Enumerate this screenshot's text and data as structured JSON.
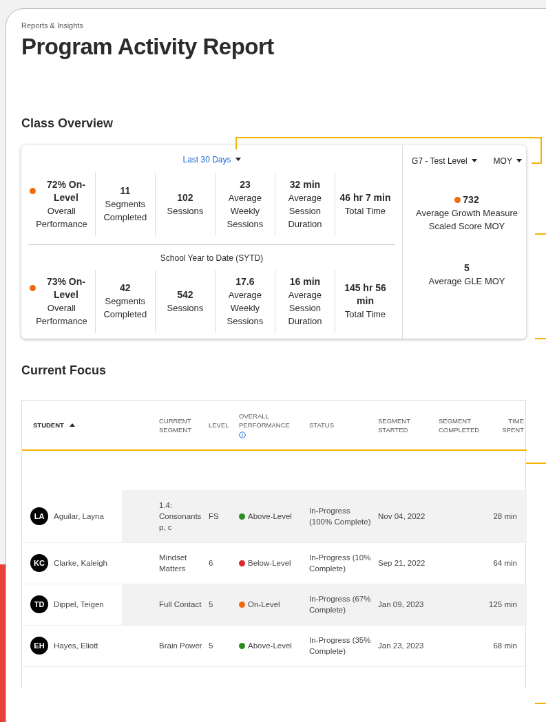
{
  "breadcrumb": "Reports & Insights",
  "title": "Program Activity Report",
  "class_overview": {
    "heading": "Class Overview",
    "period_filter": "Last 30 Days",
    "periods": [
      {
        "stats": [
          {
            "kind": "performance",
            "value": "72% On-Level",
            "label": "Overall Performance",
            "color": "#ee6c0c"
          },
          {
            "kind": "plain",
            "value": "11",
            "label": "Segments Completed"
          },
          {
            "kind": "plain",
            "value": "102",
            "label": "Sessions"
          },
          {
            "kind": "plain",
            "value": "23",
            "label": "Average Weekly Sessions"
          },
          {
            "kind": "plain",
            "value": "32 min",
            "label": "Average Session Duration"
          },
          {
            "kind": "plain",
            "value": "46 hr 7 min",
            "label": "Total Time"
          }
        ]
      },
      {
        "label": "School Year to Date (SYTD)",
        "stats": [
          {
            "kind": "performance",
            "value": "73% On-Level",
            "label": "Overall Performance",
            "color": "#ee6c0c"
          },
          {
            "kind": "plain",
            "value": "42",
            "label": "Segments Completed"
          },
          {
            "kind": "plain",
            "value": "542",
            "label": "Sessions"
          },
          {
            "kind": "plain",
            "value": "17.6",
            "label": "Average Weekly Sessions"
          },
          {
            "kind": "plain",
            "value": "16 min",
            "label": "Average Session Duration"
          },
          {
            "kind": "plain",
            "value": "145 hr 56 min",
            "label": "Total Time"
          }
        ]
      }
    ],
    "level_filter": "G7 - Test Level",
    "term_filter": "MOY",
    "measures": [
      {
        "value": "732",
        "label": "Average Growth Measure Scaled Score MOY",
        "color": "#ee6c0c"
      },
      {
        "value": "5",
        "label": "Average GLE MOY"
      }
    ]
  },
  "current_focus": {
    "heading": "Current Focus",
    "columns": [
      {
        "label": "STUDENT",
        "sorted": true
      },
      {
        "label": "CURRENT SEGMENT",
        "sorted": false
      },
      {
        "label": "LEVEL",
        "sorted": false
      },
      {
        "label": "OVERALL PERFORMANCE",
        "sorted": false,
        "info": true
      },
      {
        "label": "STATUS",
        "sorted": false
      },
      {
        "label": "SEGMENT STARTED",
        "sorted": false
      },
      {
        "label": "SEGMENT COMPLETED",
        "sorted": false
      },
      {
        "label": "TIME SPENT",
        "sorted": false
      }
    ],
    "rows": [
      {
        "initials": "LA",
        "student": "Aguilar, Layna",
        "segment": "1.4: Consonants p, c",
        "level": "FS",
        "performance": "Above-Level",
        "color": "#2e8b22",
        "status": "In-Progress (100% Complete)",
        "started": "Nov 04, 2022",
        "time": "28 min"
      },
      {
        "initials": "KC",
        "student": "Clarke, Kaleigh",
        "segment": "Mindset Matters",
        "level": "6",
        "performance": "Below-Level",
        "color": "#d82a2a",
        "status": "In-Progress (10% Complete)",
        "started": "Sep 21, 2022",
        "time": "64 min"
      },
      {
        "initials": "TD",
        "student": "Dippel, Teigen",
        "segment": "Full Contact",
        "level": "5",
        "performance": "On-Level",
        "color": "#ee6c0c",
        "status": "In-Progress (67% Complete)",
        "started": "Jan 09, 2023",
        "time": "125 min"
      },
      {
        "initials": "EH",
        "student": "Hayes, Eliott",
        "segment": "Brain Power",
        "level": "5",
        "performance": "Above-Level",
        "color": "#2e8b22",
        "status": "In-Progress (35% Complete)",
        "started": "Jan 23, 2023",
        "time": "68 min"
      }
    ]
  }
}
